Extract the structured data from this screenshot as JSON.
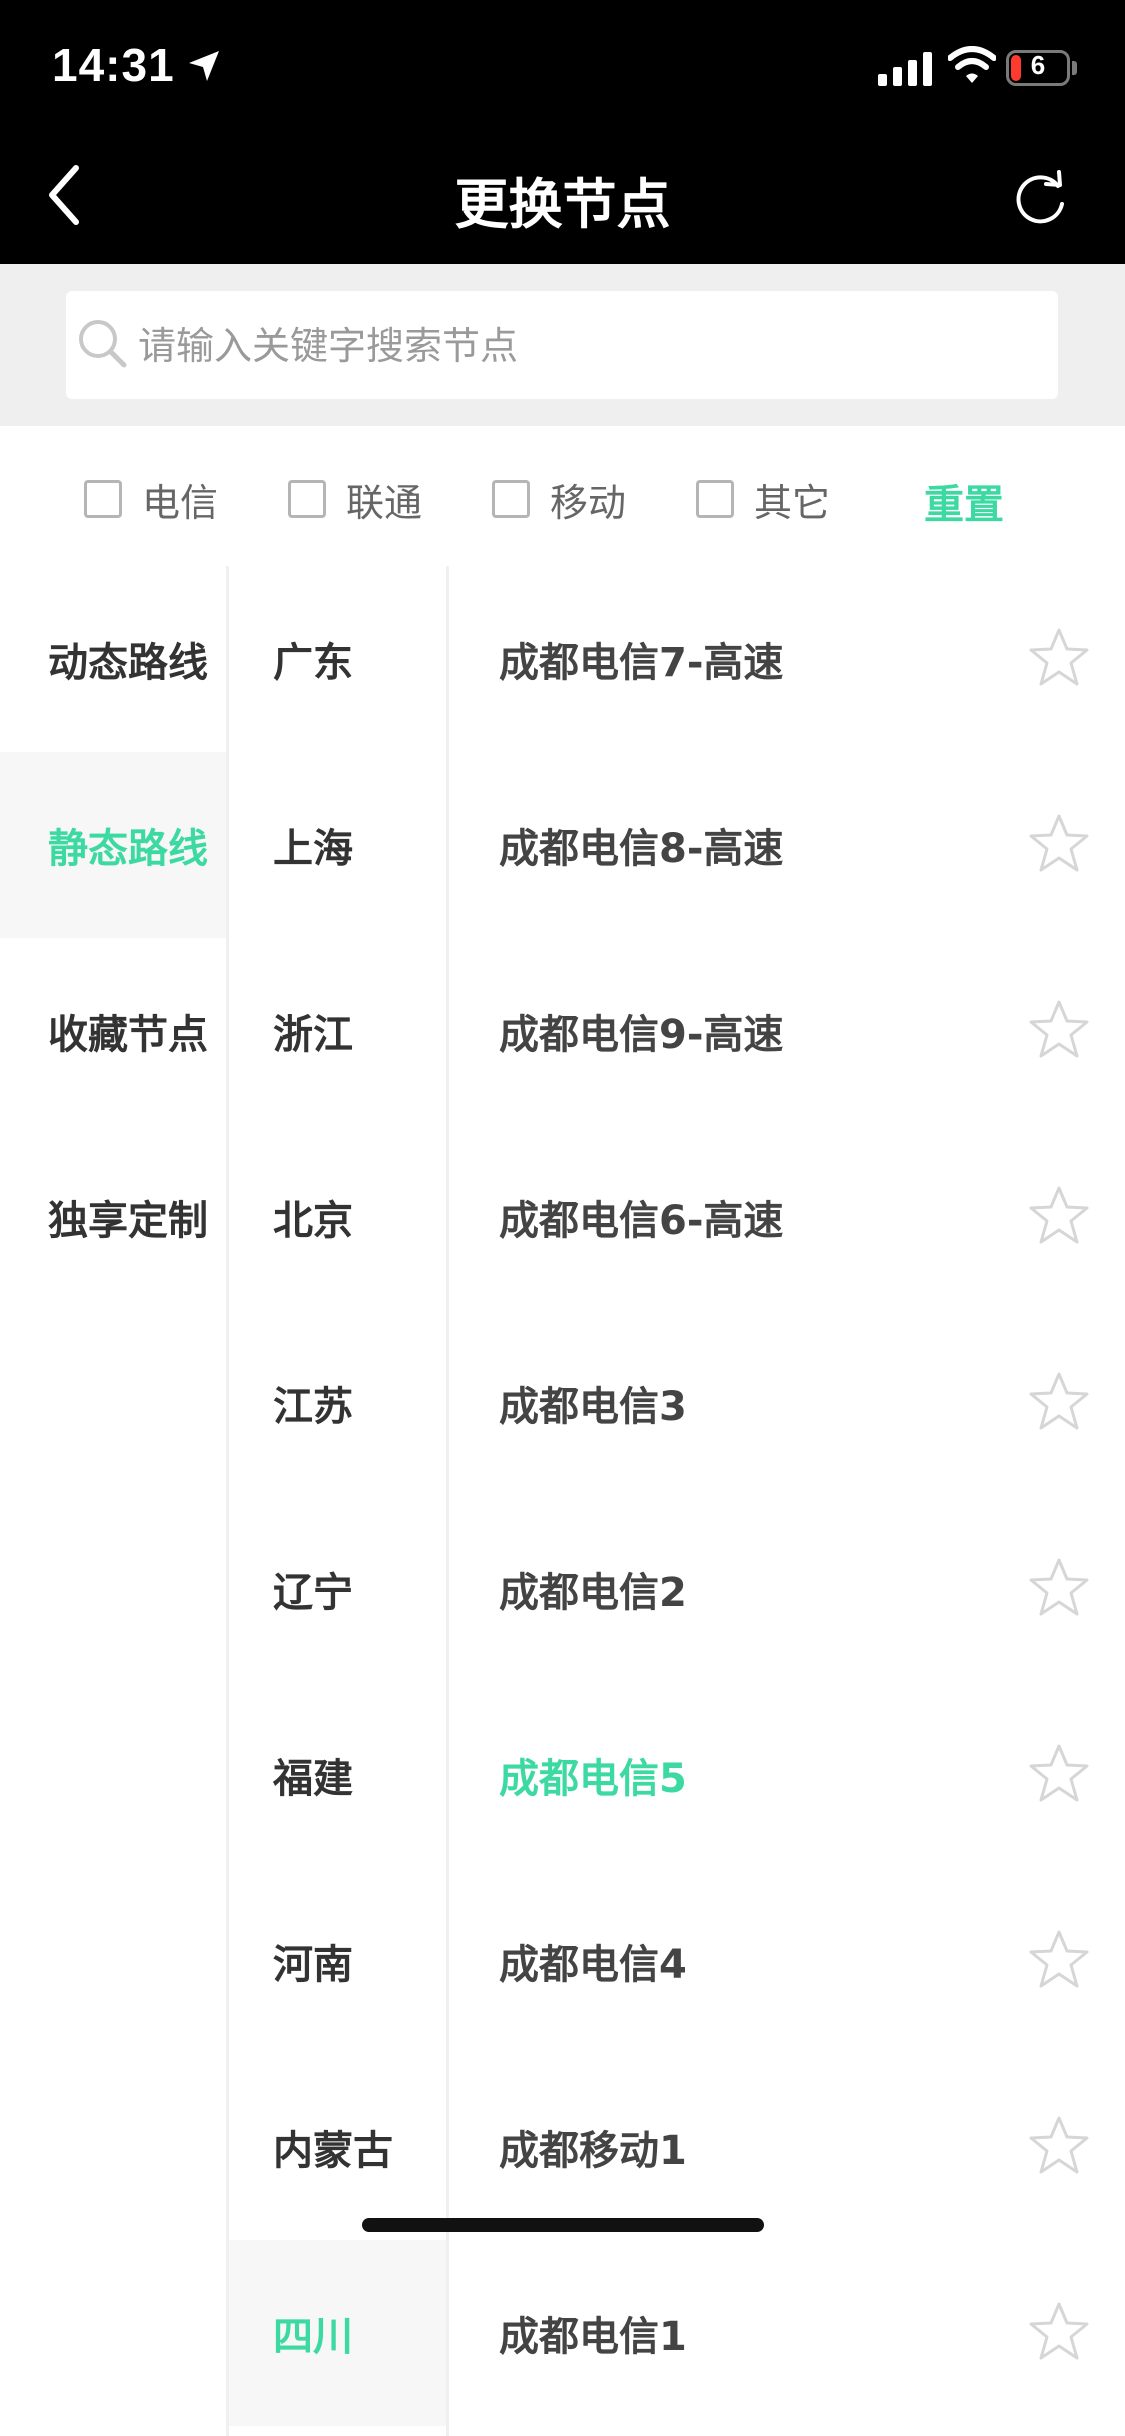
{
  "status_bar": {
    "time": "14:31",
    "battery": "6",
    "icons": [
      "location-arrow-icon",
      "signal-icon",
      "wifi-icon",
      "battery-charging-icon"
    ]
  },
  "header": {
    "title": "更换节点",
    "back_icon": "chevron-left-icon",
    "refresh_icon": "refresh-icon"
  },
  "search": {
    "placeholder": "请输入关键字搜索节点",
    "value": "",
    "icon": "search-icon"
  },
  "filters": {
    "options": [
      {
        "label": "电信",
        "checked": false
      },
      {
        "label": "联通",
        "checked": false
      },
      {
        "label": "移动",
        "checked": false
      },
      {
        "label": "其它",
        "checked": false
      }
    ],
    "reset_label": "重置"
  },
  "categories": [
    {
      "label": "动态路线",
      "active": false
    },
    {
      "label": "静态路线",
      "active": true
    },
    {
      "label": "收藏节点",
      "active": false
    },
    {
      "label": "独享定制",
      "active": false
    }
  ],
  "regions": [
    {
      "label": "广东",
      "active": false
    },
    {
      "label": "上海",
      "active": false
    },
    {
      "label": "浙江",
      "active": false
    },
    {
      "label": "北京",
      "active": false
    },
    {
      "label": "江苏",
      "active": false
    },
    {
      "label": "辽宁",
      "active": false
    },
    {
      "label": "福建",
      "active": false
    },
    {
      "label": "河南",
      "active": false
    },
    {
      "label": "内蒙古",
      "active": false
    },
    {
      "label": "四川",
      "active": true
    }
  ],
  "nodes": [
    {
      "name": "成都电信7-高速",
      "selected": false,
      "favorite": false
    },
    {
      "name": "成都电信8-高速",
      "selected": false,
      "favorite": false
    },
    {
      "name": "成都电信9-高速",
      "selected": false,
      "favorite": false
    },
    {
      "name": "成都电信6-高速",
      "selected": false,
      "favorite": false
    },
    {
      "name": "成都电信3",
      "selected": false,
      "favorite": false
    },
    {
      "name": "成都电信2",
      "selected": false,
      "favorite": false
    },
    {
      "name": "成都电信5",
      "selected": true,
      "favorite": false
    },
    {
      "name": "成都电信4",
      "selected": false,
      "favorite": false
    },
    {
      "name": "成都移动1",
      "selected": false,
      "favorite": false
    },
    {
      "name": "成都电信1",
      "selected": false,
      "favorite": false
    }
  ],
  "colors": {
    "accent": "#3dd9a3",
    "header_bg": "#000000",
    "search_bg": "#efefef",
    "active_row_bg": "#f7f7f7",
    "text": "#333333"
  }
}
